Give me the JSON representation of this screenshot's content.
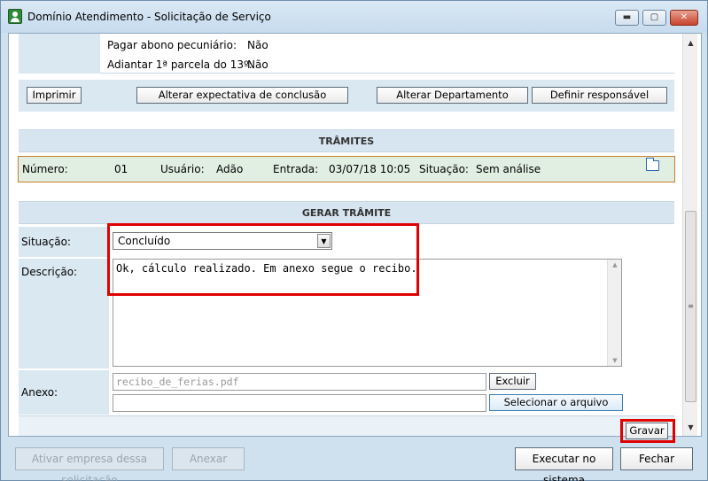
{
  "window": {
    "title": "Domínio Atendimento - Solicitação de Serviço",
    "minimize_glyph": "▬",
    "maximize_glyph": "▢",
    "close_glyph": "✕"
  },
  "info": {
    "row1_label": "Pagar abono pecuniário:",
    "row1_value": "Não",
    "row2_label": "Adiantar 1ª parcela do 13º:",
    "row2_value": "Não"
  },
  "actions": {
    "print": "Imprimir",
    "change_expectation": "Alterar expectativa de conclusão",
    "change_department": "Alterar Departamento",
    "define_responsible": "Definir responsável"
  },
  "tramites": {
    "header": "TRÂMITES",
    "numero_label": "Número:",
    "numero_value": "01",
    "usuario_label": "Usuário:",
    "usuario_value": "Adão",
    "entrada_label": "Entrada:",
    "entrada_value": "03/07/18 10:05",
    "situacao_label": "Situação:",
    "situacao_value": "Sem análise"
  },
  "gerar": {
    "header": "GERAR TRÂMITE",
    "situacao_label": "Situação:",
    "situacao_value": "Concluído",
    "descricao_label": "Descrição:",
    "descricao_value": "Ok, cálculo realizado. Em anexo segue o recibo.",
    "anexo_label": "Anexo:",
    "anexo_file": "recibo_de_ferias.pdf",
    "anexo_path": "",
    "excluir": "Excluir",
    "selecionar": "Selecionar o arquivo",
    "gravar": "Gravar"
  },
  "footer": {
    "ativar": "Ativar empresa dessa solicitação",
    "anexar": "Anexar",
    "executar": "Executar no sistema",
    "fechar": "Fechar"
  },
  "colors": {
    "highlight": "#e00000",
    "row_green": "#e1efe2",
    "row_border": "#c9802a"
  }
}
